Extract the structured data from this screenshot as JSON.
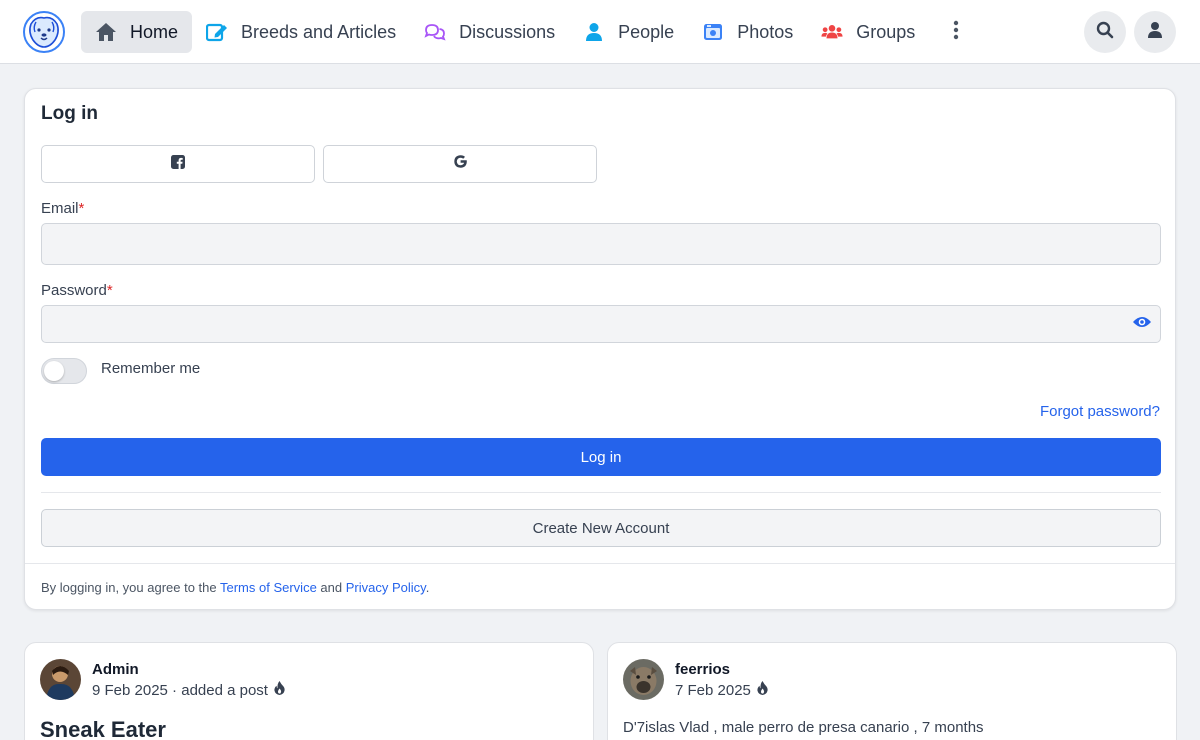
{
  "colors": {
    "primary": "#2563eb",
    "required": "#dc2626"
  },
  "nav": {
    "items": [
      {
        "label": "Home",
        "icon": "home-icon",
        "active": true
      },
      {
        "label": "Breeds and Articles",
        "icon": "edit-icon"
      },
      {
        "label": "Discussions",
        "icon": "comments-icon"
      },
      {
        "label": "People",
        "icon": "person-icon"
      },
      {
        "label": "Photos",
        "icon": "camera-icon"
      },
      {
        "label": "Groups",
        "icon": "users-icon"
      }
    ],
    "more_icon": "more-vertical-icon",
    "search_icon": "search-icon",
    "user_icon": "user-icon"
  },
  "login": {
    "title": "Log in",
    "facebook_icon": "facebook-icon",
    "google_icon": "google-icon",
    "email_label": "Email",
    "password_label": "Password",
    "required_mark": "*",
    "email_value": "",
    "password_value": "",
    "remember_label": "Remember me",
    "remember_checked": false,
    "forgot_label": "Forgot password?",
    "submit_label": "Log in",
    "create_label": "Create New Account",
    "terms_prefix": "By logging in, you agree to the ",
    "terms_link": "Terms of Service",
    "terms_and": " and ",
    "privacy_link": "Privacy Policy",
    "terms_suffix": "."
  },
  "posts": [
    {
      "author": "Admin",
      "meta": "9 Feb 2025 · added a post",
      "title": "Sneak Eater",
      "text": ""
    },
    {
      "author": "feerrios",
      "meta": "7 Feb 2025",
      "title": "",
      "text": "D'7islas Vlad , male perro de presa canario , 7 months"
    }
  ]
}
